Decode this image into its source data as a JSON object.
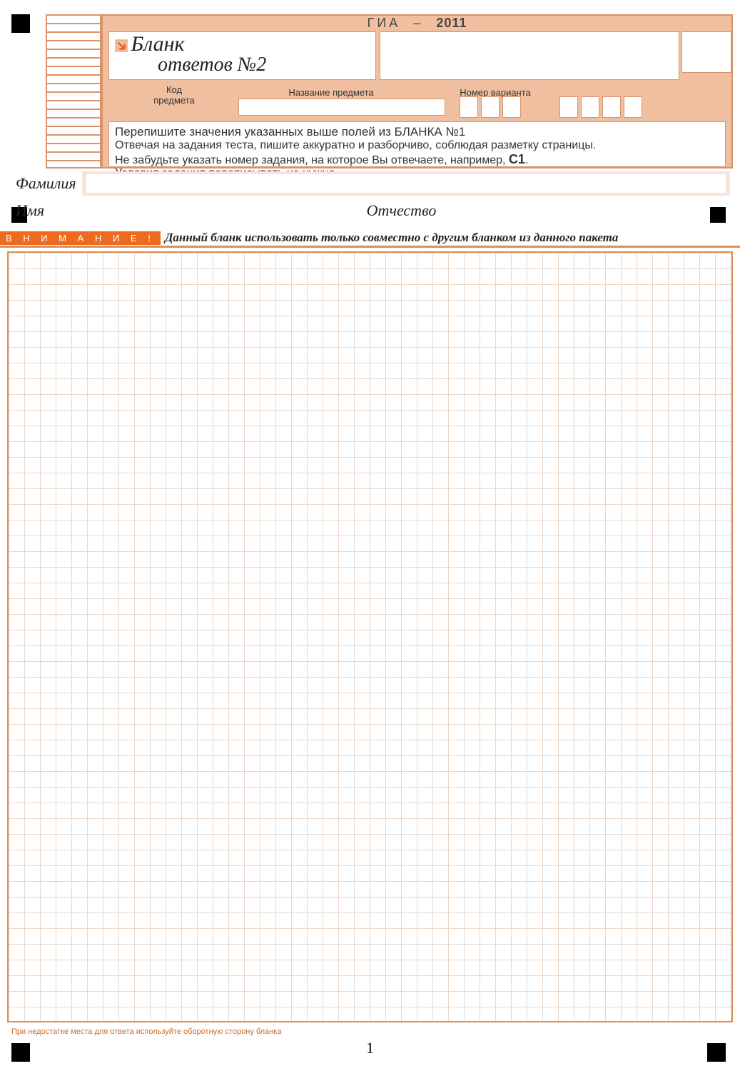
{
  "header": {
    "exam_label": "ГИА",
    "dash": "–",
    "year": "2011",
    "title_line1": "Бланк",
    "title_line2": "ответов №2",
    "subject_code_label_l1": "Код",
    "subject_code_label_l2": "предмета",
    "subject_name_label": "Название предмета",
    "variant_label": "Номер варианта",
    "variant_cell_count": 3,
    "barcode_cell_count": 4
  },
  "instructions": {
    "line1": "Перепишите значения указанных выше полей из БЛАНКА №1",
    "line2": "Отвечая на задания теста, пишите аккуратно и разборчиво, соблюдая разметку страницы.",
    "line3_a": "Не забудьте указать номер задания, на которое Вы отвечаете, например, ",
    "line3_b": "С1",
    "line3_c": ".",
    "line4": "Условия задания переписывать не нужно."
  },
  "name_section": {
    "surname_label": "Фамилия",
    "firstname_label": "Имя",
    "patronymic_label": "Отчество"
  },
  "warning": {
    "tag": "В Н И М А Н И Е !",
    "text": "Данный бланк использовать только совместно с  другим бланком из данного пакета"
  },
  "footer": {
    "note": "При недостатке места для ответа используйте оборотную сторону бланка",
    "page_number": "1"
  },
  "colors": {
    "accent": "#e08e58",
    "fill": "#f0bfa0",
    "warn": "#ec6b1f"
  }
}
